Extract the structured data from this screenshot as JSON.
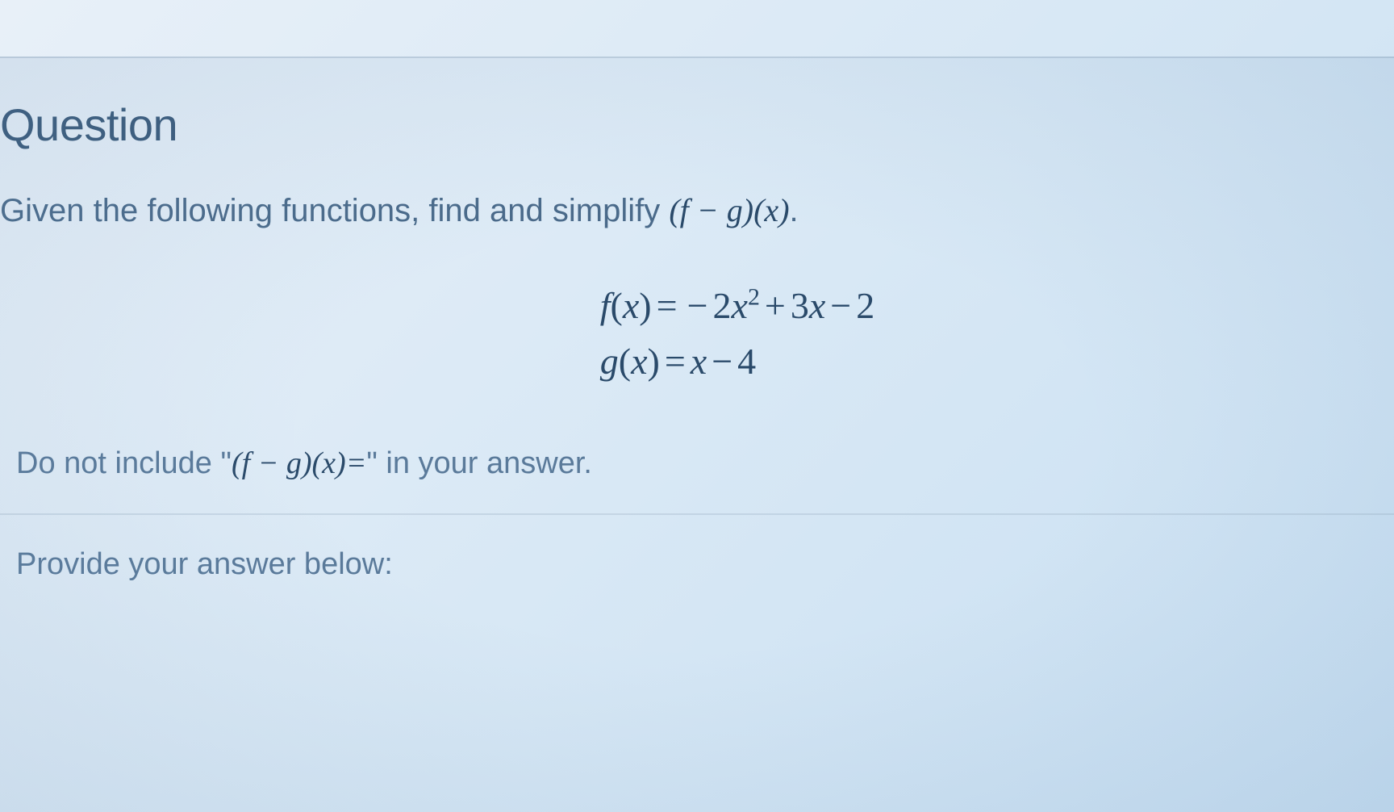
{
  "title": "Question",
  "prompt_prefix": "Given the following functions, find and simplify ",
  "prompt_math": "(f − g)(x)",
  "prompt_suffix": ".",
  "equations": {
    "f": "f(x) = −2x² + 3x − 2",
    "g": "g(x) = x − 4"
  },
  "note_prefix": "Do not include \"",
  "note_math": "(f − g)(x)=",
  "note_suffix": "\" in your answer.",
  "answer_prompt": "Provide your answer below:"
}
